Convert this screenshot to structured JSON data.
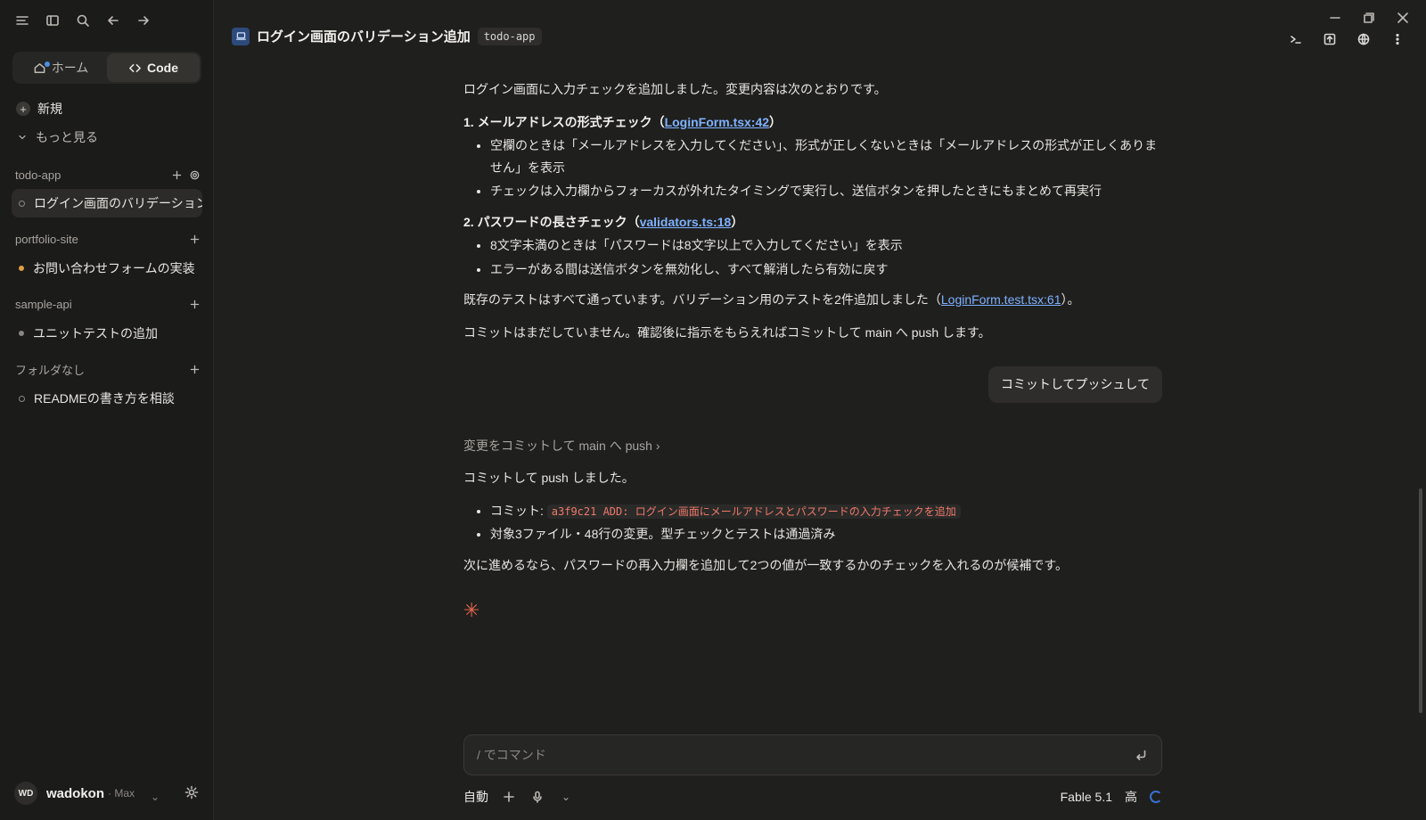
{
  "sidebar": {
    "mode_home": "ホーム",
    "mode_code": "Code",
    "new_label": "新規",
    "more_label": "もっと見る",
    "groups": [
      {
        "name": "todo-app",
        "sessions": [
          {
            "title": "ログイン画面のバリデーション追加",
            "status": "idle"
          }
        ]
      },
      {
        "name": "portfolio-site",
        "sessions": [
          {
            "title": "お問い合わせフォームの実装",
            "status": "unread"
          }
        ]
      },
      {
        "name": "sample-api",
        "sessions": [
          {
            "title": "ユニットテストの追加",
            "status": "done"
          }
        ]
      },
      {
        "name": "フォルダなし",
        "sessions": [
          {
            "title": "READMEの書き方を相談",
            "status": "idle"
          }
        ]
      }
    ],
    "user": {
      "initials": "WD",
      "name": "wadokon",
      "plan": "· Max"
    }
  },
  "header": {
    "title": "ログイン画面のバリデーション追加",
    "repo": "todo-app"
  },
  "chat": {
    "intro": "ログイン画面に入力チェックを追加しました。変更内容は次のとおりです。",
    "s1_title": "1. メールアドレスの形式チェック（",
    "s1_link": "LoginForm.tsx:42",
    "s1_close": "）",
    "s1_items": [
      "空欄のときは「メールアドレスを入力してください」、形式が正しくないときは「メールアドレスの形式が正しくありません」を表示",
      "チェックは入力欄からフォーカスが外れたタイミングで実行し、送信ボタンを押したときにもまとめて再実行"
    ],
    "s2_title": "2. パスワードの長さチェック（",
    "s2_link": "validators.ts:18",
    "s2_close": "）",
    "s2_items": [
      "8文字未満のときは「パスワードは8文字以上で入力してください」を表示",
      "エラーがある間は送信ボタンを無効化し、すべて解消したら有効に戻す"
    ],
    "tests_pre": "既存のテストはすべて通っています。バリデーション用のテストを2件追加しました（",
    "tests_link": "LoginForm.test.tsx:61",
    "tests_post": "）。",
    "commit_note": "コミットはまだしていません。確認後に指示をもらえればコミットして main へ push します。",
    "user_msg": "コミットしてプッシュして",
    "tool_line": "変更をコミットして main へ push ›",
    "done": "コミットして push しました。",
    "commit_label": "コミット: ",
    "commit_code": "a3f9c21 ADD: ログイン画面にメールアドレスとパスワードの入力チェックを追加",
    "files_note": "対象3ファイル・48行の変更。型チェックとテストは通過済み",
    "next": "次に進めるなら、パスワードの再入力欄を追加して2つの値が一致するかのチェックを入れるのが候補です。"
  },
  "composer": {
    "placeholder": "/ でコマンド",
    "mode": "自動",
    "model": "Fable 5.1",
    "effort": "高"
  },
  "colors": {
    "accent": "#e0654a",
    "link": "#7fb2ff",
    "code": "#f0796b"
  }
}
